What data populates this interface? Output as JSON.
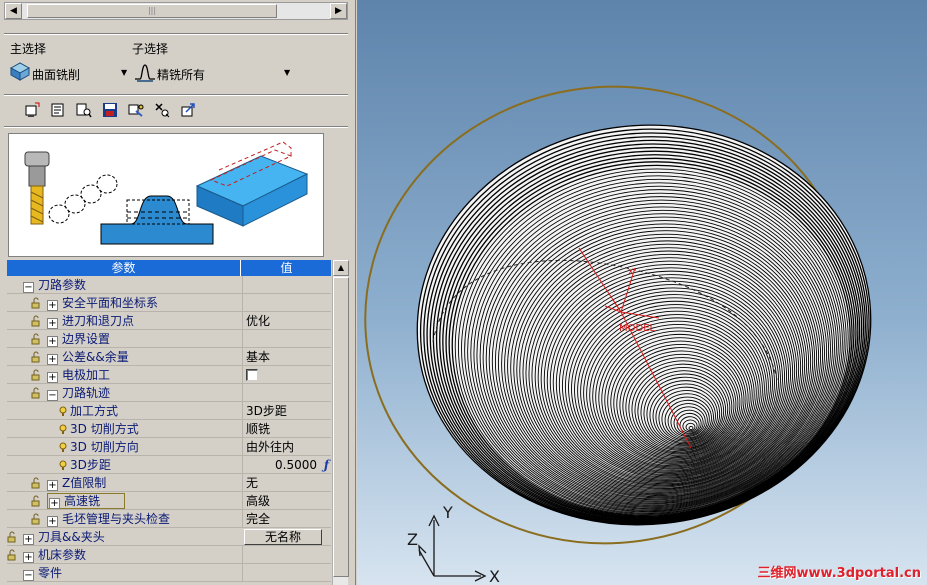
{
  "panel": {
    "main_select_label": "主选择",
    "sub_select_label": "子选择",
    "main_select_value": "曲面铣削",
    "sub_select_value": "精铣所有",
    "main_select_icon": "surface-mill-icon",
    "sub_select_icon": "finish-all-icon",
    "toolbar_icons": [
      "new-icon",
      "open-icon",
      "find-icon",
      "save-icon",
      "tool-icon",
      "settings-icon",
      "export-icon"
    ]
  },
  "grid": {
    "header_param": "参数",
    "header_value": "值",
    "rows": [
      {
        "name": "刀路参数",
        "value": ""
      },
      {
        "name": "安全平面和坐标系",
        "value": ""
      },
      {
        "name": "进刀和退刀点",
        "value": "优化"
      },
      {
        "name": "边界设置",
        "value": ""
      },
      {
        "name": "公差&&余量",
        "value": "基本"
      },
      {
        "name": "电极加工",
        "value": ""
      },
      {
        "name": "刀路轨迹",
        "value": ""
      },
      {
        "name": "加工方式",
        "value": "3D步距"
      },
      {
        "name": "3D  切削方式",
        "value": "顺铣"
      },
      {
        "name": "3D  切削方向",
        "value": "由外往内"
      },
      {
        "name": "3D步距",
        "value": "0.5000"
      },
      {
        "name": "Z值限制",
        "value": "无"
      },
      {
        "name": "高速铣",
        "value": "高级"
      },
      {
        "name": "毛坯管理与夹头检查",
        "value": "完全"
      },
      {
        "name": "刀具&&夹头",
        "value": "无名称"
      },
      {
        "name": "机床参数",
        "value": ""
      },
      {
        "name": "零件",
        "value": ""
      }
    ],
    "formula_symbol": "ƒ"
  },
  "viewport": {
    "axis_x": "X",
    "axis_y": "Y",
    "axis_z": "Z",
    "model_label": "MODEL",
    "watermark": "三维网www.3dportal.cn",
    "colors": {
      "background_top": "#5e84ac",
      "background_bottom": "#d7e4f0",
      "toolpath": "#000000",
      "boundary_ring": "#8a6d1e",
      "coordinate_marker": "#e01818"
    }
  }
}
